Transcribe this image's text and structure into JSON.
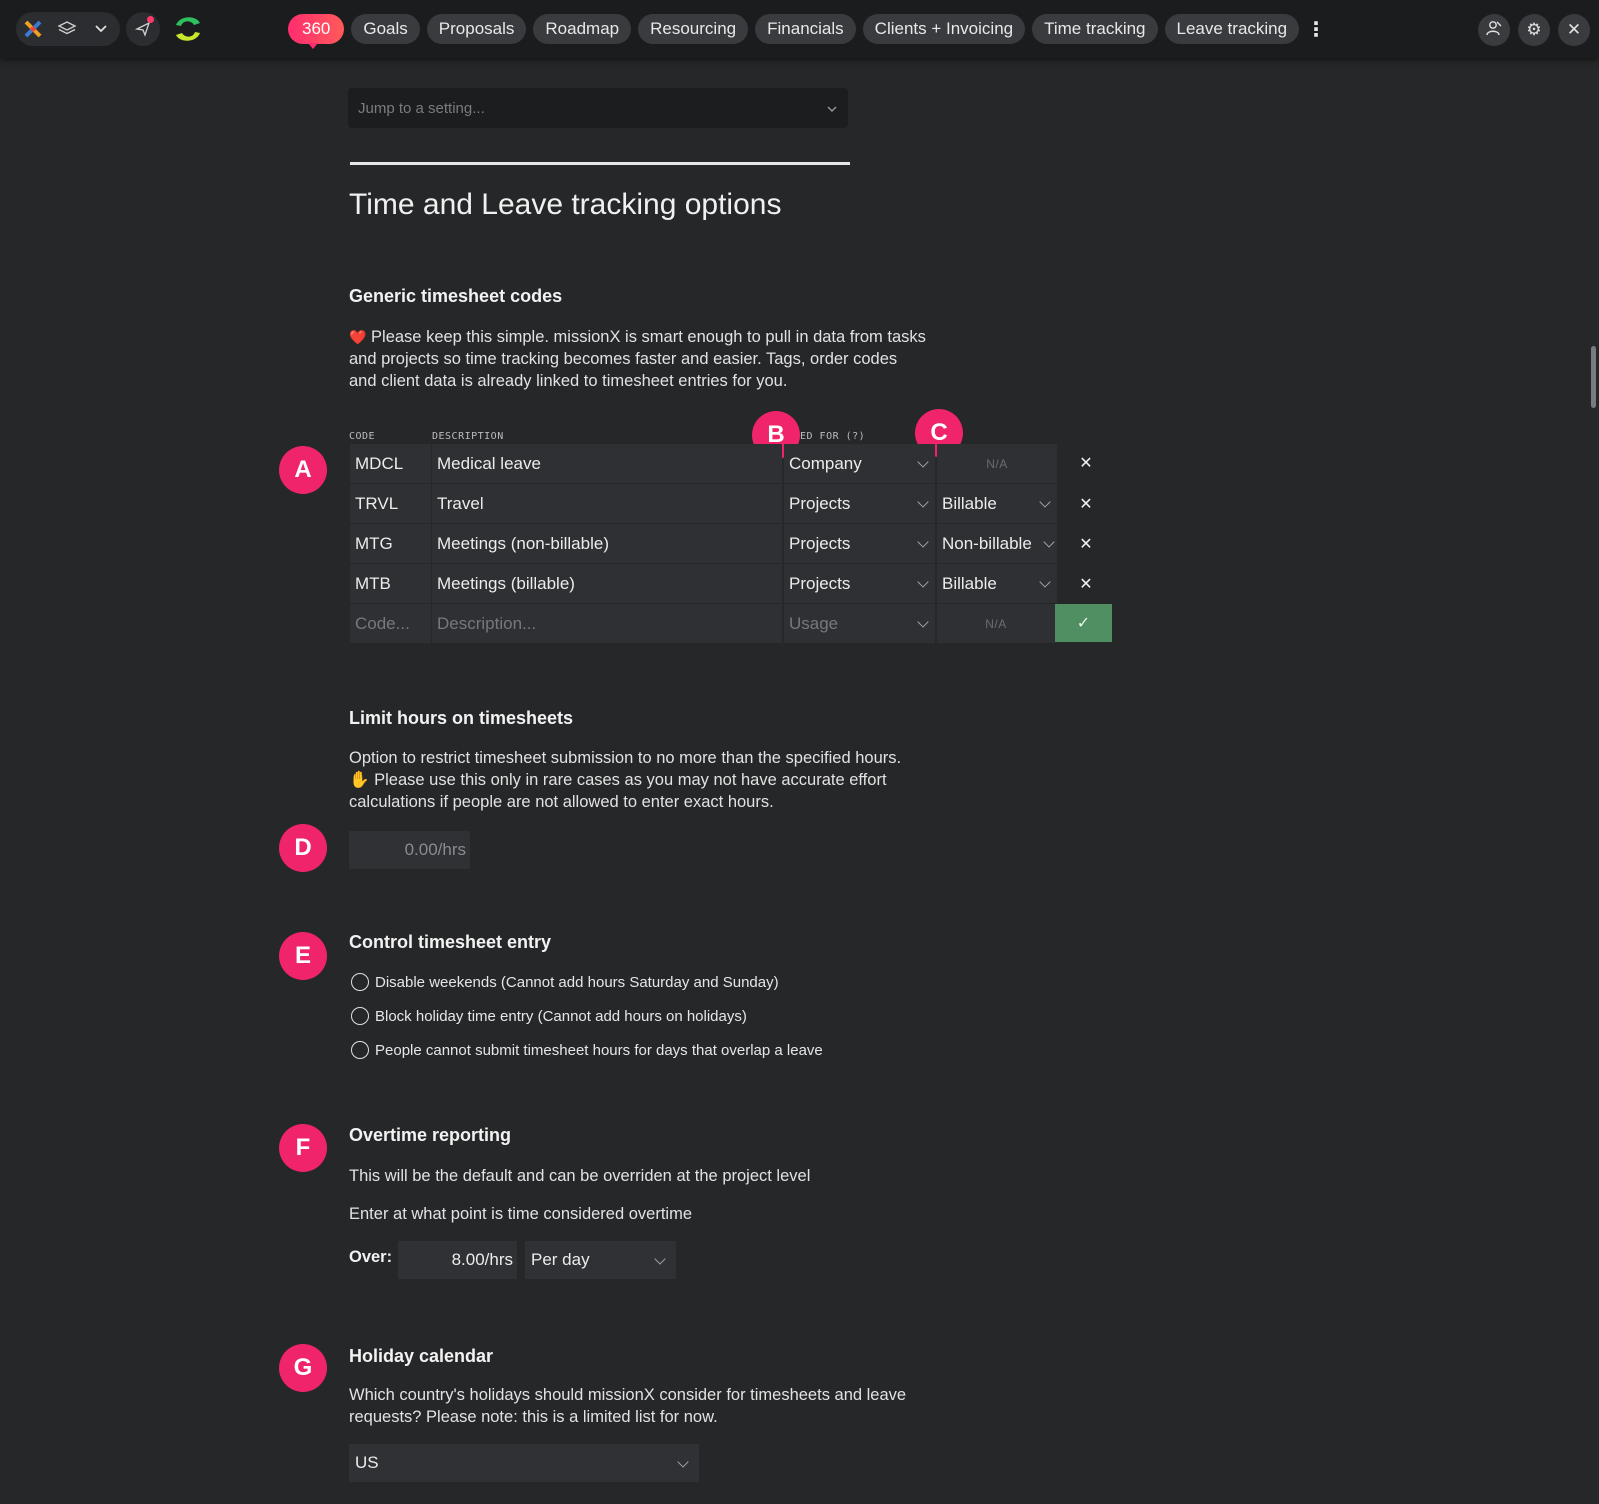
{
  "topbar": {
    "nav": [
      {
        "label": "360",
        "badge": true
      },
      {
        "label": "Goals"
      },
      {
        "label": "Proposals"
      },
      {
        "label": "Roadmap"
      },
      {
        "label": "Resourcing"
      },
      {
        "label": "Financials"
      },
      {
        "label": "Clients + Invoicing"
      },
      {
        "label": "Time tracking"
      },
      {
        "label": "Leave tracking"
      }
    ],
    "icons": [
      "app-logo-icon",
      "layers-icon",
      "chevron-down-icon",
      "send-icon",
      "brand-logo-icon",
      "more-vertical-icon",
      "user-switch-icon",
      "gear-icon",
      "close-icon"
    ]
  },
  "jump_to": {
    "placeholder": "Jump to a setting..."
  },
  "page_title": "Time and Leave tracking options",
  "generic_codes": {
    "heading": "Generic timesheet codes",
    "description": "Please keep this simple. missionX is smart enough to pull in data from tasks and projects so time tracking becomes faster and easier. Tags, order codes and client data is already linked to timesheet entries for you.",
    "columns": {
      "code": "CODE",
      "description": "DESCRIPTION",
      "used_for": "ED FOR (?)"
    },
    "rows": [
      {
        "code": "MDCL",
        "description": "Medical leave",
        "usage": "Company",
        "billing": "N/A"
      },
      {
        "code": "TRVL",
        "description": "Travel",
        "usage": "Projects",
        "billing": "Billable"
      },
      {
        "code": "MTG",
        "description": "Meetings (non-billable)",
        "usage": "Projects",
        "billing": "Non-billable"
      },
      {
        "code": "MTB",
        "description": "Meetings (billable)",
        "usage": "Projects",
        "billing": "Billable"
      }
    ],
    "new_row": {
      "code_placeholder": "Code...",
      "description_placeholder": "Description...",
      "usage_placeholder": "Usage",
      "billing": "N/A"
    }
  },
  "limit_hours": {
    "heading": "Limit hours on timesheets",
    "description_1": "Option to restrict timesheet submission to no more than the specified hours.",
    "description_2": "Please use this only in rare cases as you may not have accurate effort calculations if people are not allowed to enter exact hours.",
    "value": "0.00/hrs"
  },
  "control_entry": {
    "heading": "Control timesheet entry",
    "options": [
      {
        "label": "Disable weekends (Cannot add hours Saturday and Sunday)",
        "checked": false
      },
      {
        "label": "Block holiday time entry (Cannot add hours on holidays)",
        "checked": false
      },
      {
        "label": "People cannot submit timesheet hours for days that overlap a leave",
        "checked": false
      }
    ]
  },
  "overtime": {
    "heading": "Overtime reporting",
    "description_1": "This will be the default and can be overriden at the project level",
    "description_2": "Enter at what point is time considered overtime",
    "over_label": "Over:",
    "hours": "8.00/hrs",
    "period": "Per day"
  },
  "holiday": {
    "heading": "Holiday calendar",
    "description": "Which country's holidays should missionX consider for timesheets and leave requests? Please note: this is a limited list for now.",
    "country": "US"
  },
  "markers": [
    "A",
    "B",
    "C",
    "D",
    "E",
    "F",
    "G"
  ],
  "colors": {
    "accent": "#f0246a",
    "confirm": "#4f8f62",
    "background": "#262729"
  }
}
